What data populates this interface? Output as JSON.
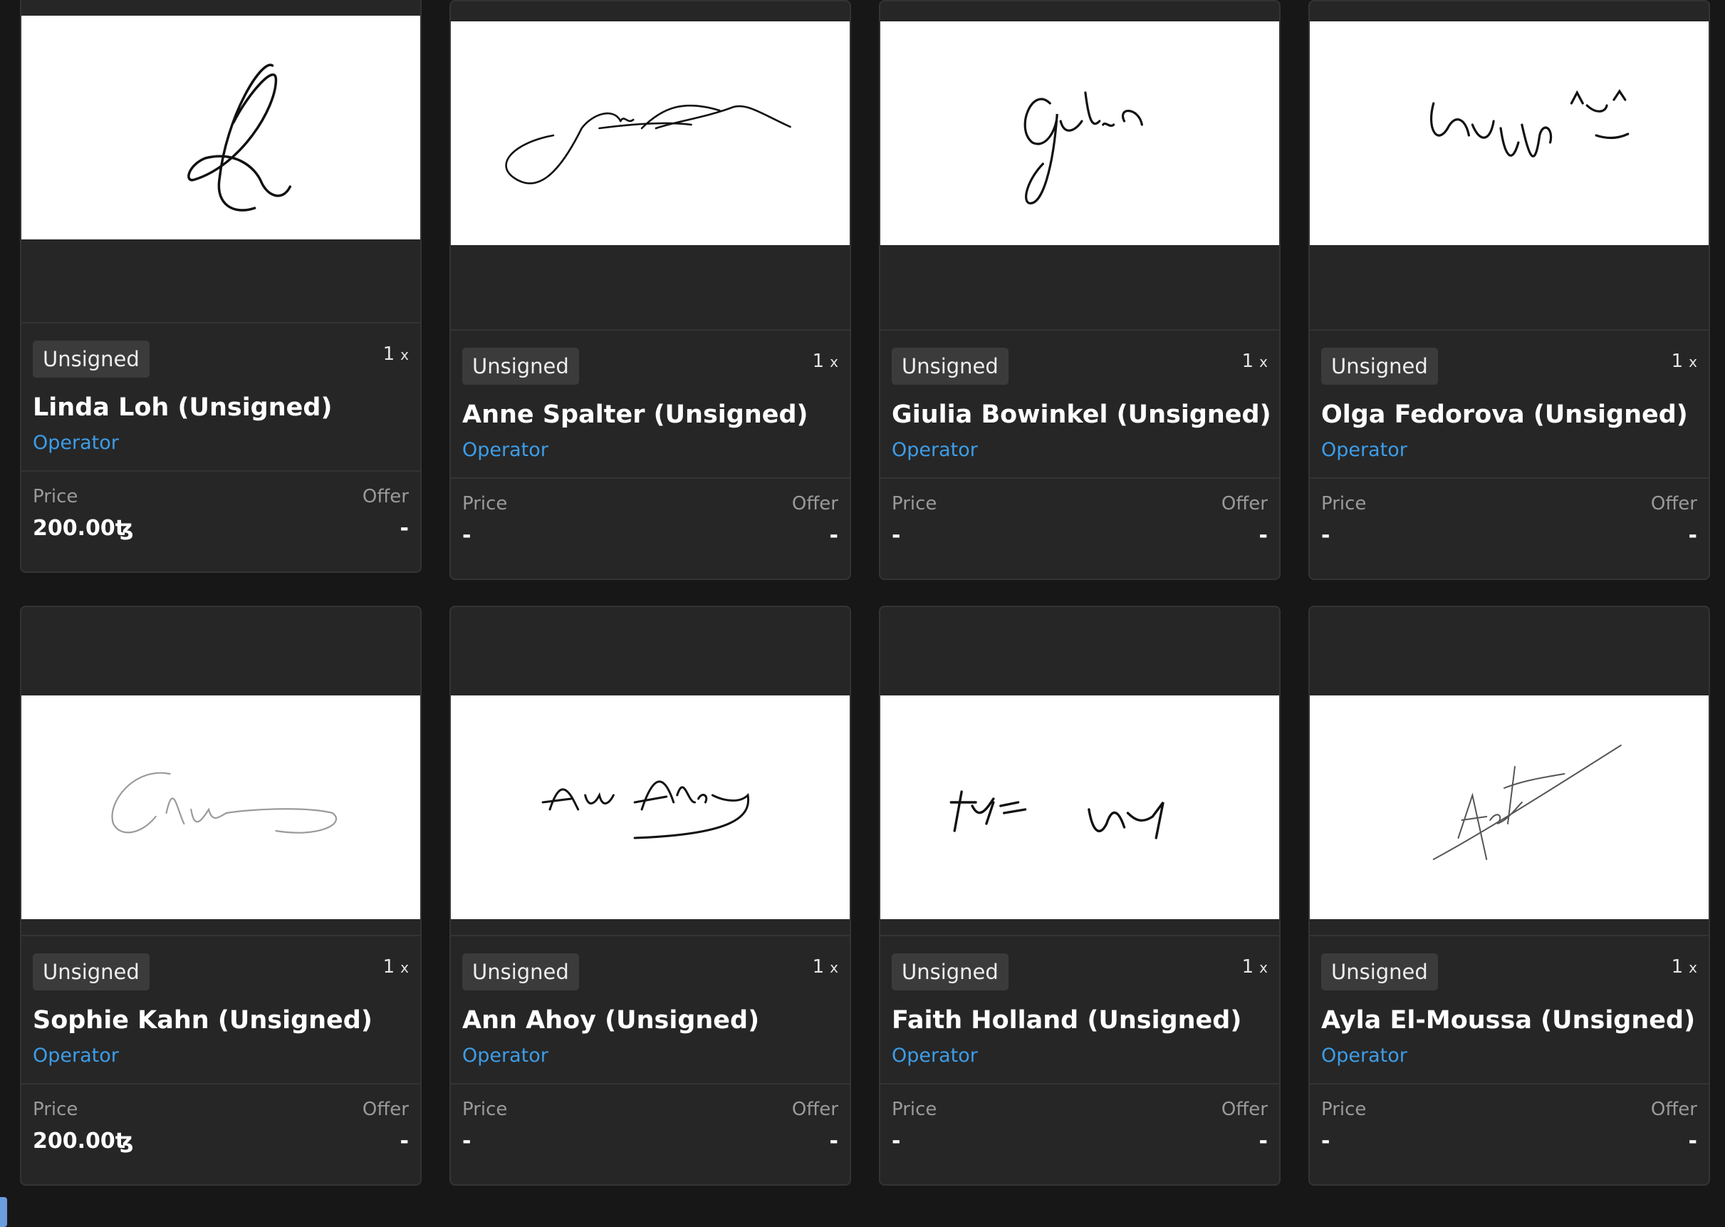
{
  "cards": [
    {
      "badge": "Unsigned",
      "quantity": "1",
      "qty_suffix": "x",
      "title": "Linda Loh (Unsigned)",
      "creator": "Operator",
      "price_label": "Price",
      "offer_label": "Offer",
      "price": "200.00ꜩ",
      "offer": "-"
    },
    {
      "badge": "Unsigned",
      "quantity": "1",
      "qty_suffix": "x",
      "title": "Anne Spalter (Unsigned)",
      "creator": "Operator",
      "price_label": "Price",
      "offer_label": "Offer",
      "price": "-",
      "offer": "-"
    },
    {
      "badge": "Unsigned",
      "quantity": "1",
      "qty_suffix": "x",
      "title": "Giulia Bowinkel (Unsigned)",
      "creator": "Operator",
      "price_label": "Price",
      "offer_label": "Offer",
      "price": "-",
      "offer": "-"
    },
    {
      "badge": "Unsigned",
      "quantity": "1",
      "qty_suffix": "x",
      "title": "Olga Fedorova (Unsigned)",
      "creator": "Operator",
      "price_label": "Price",
      "offer_label": "Offer",
      "price": "-",
      "offer": "-"
    },
    {
      "badge": "Unsigned",
      "quantity": "1",
      "qty_suffix": "x",
      "title": "Sophie Kahn (Unsigned)",
      "creator": "Operator",
      "price_label": "Price",
      "offer_label": "Offer",
      "price": "200.00ꜩ",
      "offer": "-"
    },
    {
      "badge": "Unsigned",
      "quantity": "1",
      "qty_suffix": "x",
      "title": "Ann Ahoy (Unsigned)",
      "creator": "Operator",
      "price_label": "Price",
      "offer_label": "Offer",
      "price": "-",
      "offer": "-"
    },
    {
      "badge": "Unsigned",
      "quantity": "1",
      "qty_suffix": "x",
      "title": "Faith Holland (Unsigned)",
      "creator": "Operator",
      "price_label": "Price",
      "offer_label": "Offer",
      "price": "-",
      "offer": "-"
    },
    {
      "badge": "Unsigned",
      "quantity": "1",
      "qty_suffix": "x",
      "title": "Ayla El-Moussa (Unsigned)",
      "creator": "Operator",
      "price_label": "Price",
      "offer_label": "Offer",
      "price": "-",
      "offer": "-"
    }
  ],
  "colors": {
    "page_bg": "#171717",
    "card_bg": "#262626",
    "accent_link": "#3d9de8",
    "badge_bg": "#3b3b3b"
  }
}
